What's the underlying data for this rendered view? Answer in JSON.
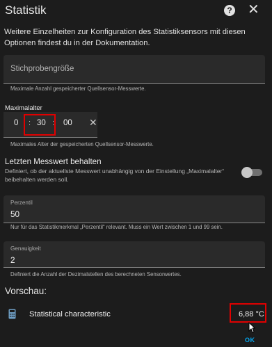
{
  "dialog": {
    "title": "Statistik",
    "help_icon": "help-circle-icon",
    "help_glyph": "?",
    "close_icon": "close-icon",
    "close_glyph": "✕"
  },
  "intro": "Weitere Einzelheiten zur Konfiguration des Statistiksensors mit diesen Optionen findest du in der Dokumentation.",
  "sampling_size": {
    "placeholder": "Stichprobengröße",
    "helper": "Maximale Anzahl gespeicherter Quellsensor-Messwerte."
  },
  "max_age": {
    "label": "Maximalalter",
    "hours": "0",
    "minutes": "30",
    "seconds": "00",
    "separator": ":",
    "clear_glyph": "✕",
    "helper": "Maximales Alter der gespeicherten Quellsensor-Messwerte."
  },
  "keep_last": {
    "title": "Letzten Messwert behalten",
    "description": "Definiert, ob der aktuellste Messwert unabhängig von der Einstellung „Maximalalter“ beibehalten werden soll.",
    "enabled": false
  },
  "percentile": {
    "label": "Perzentil",
    "value": "50",
    "helper": "Nur für das Statistikmerkmal „Perzentil“ relevant. Muss ein Wert zwischen 1 und 99 sein."
  },
  "precision": {
    "label": "Genauigkeit",
    "value": "2",
    "helper": "Definiert die Anzahl der Dezimalstellen des berechneten Sensorwertes."
  },
  "preview": {
    "title": "Vorschau:",
    "icon": "calculator-icon",
    "name": "Statistical characteristic",
    "value": "6,88 °C"
  },
  "actions": {
    "ok_label": "OK"
  },
  "colors": {
    "background": "#1c1c1c",
    "field": "#2a2a2a",
    "highlight": "#e10000",
    "primary": "#03a9f4"
  }
}
